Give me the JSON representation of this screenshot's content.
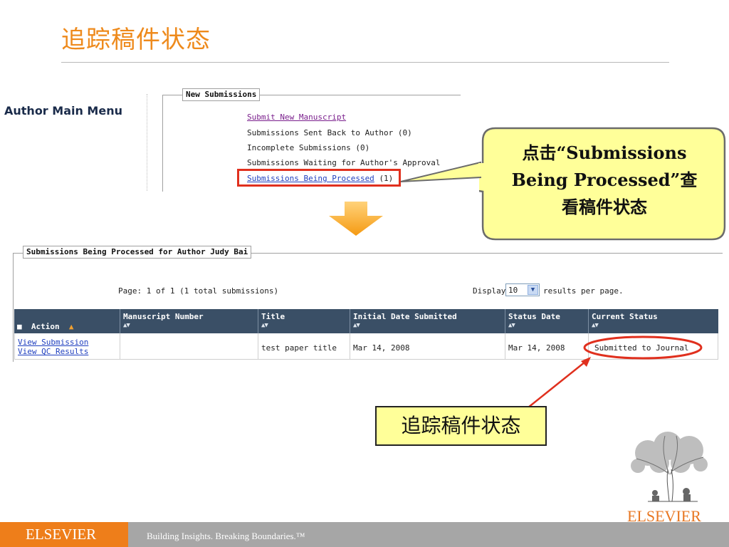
{
  "slide": {
    "title": "追踪稿件状态"
  },
  "author_menu": {
    "label": "Author Main Menu"
  },
  "new_submissions": {
    "legend": "New Submissions",
    "items": [
      {
        "label": "Submit New Manuscript"
      },
      {
        "label": "Submissions Sent Back to Author (0)"
      },
      {
        "label": "Incomplete Submissions (0)"
      },
      {
        "label": "Submissions Waiting for Author's Approval (0)"
      },
      {
        "label": "Submissions Being Processed",
        "count": "(1)"
      }
    ]
  },
  "callout": {
    "text_line1": "点击“Submissions",
    "text_line2": "Being Processed”查",
    "text_line3": "看稿件状态"
  },
  "processed": {
    "legend": "Submissions Being Processed for Author Judy Bai",
    "page_info": "Page: 1 of 1 (1 total submissions)",
    "display_label": "Display",
    "display_value": "10",
    "results_label": "results per page.",
    "columns": [
      {
        "label": "Action"
      },
      {
        "label": "Manuscript Number"
      },
      {
        "label": "Title"
      },
      {
        "label": "Initial Date Submitted"
      },
      {
        "label": "Status Date"
      },
      {
        "label": "Current Status"
      }
    ],
    "rows": [
      {
        "actions": [
          "View Submission",
          "View QC Results"
        ],
        "manuscript_number": "",
        "title": "test paper title",
        "initial_date": "Mar 14, 2008",
        "status_date": "Mar 14, 2008",
        "current_status": "Submitted to Journal"
      }
    ]
  },
  "bottom_label": "追踪稿件状态",
  "logo": {
    "wordmark": "ELSEVIER"
  },
  "footer": {
    "brand": "ELSEVIER",
    "tagline": "Building Insights. Breaking Boundaries.™"
  },
  "colors": {
    "title": "#ee8a1c",
    "callout_fill": "#ffff99",
    "highlight_red": "#e0301e",
    "table_header": "#3a4f66",
    "footer_orange": "#ee7e1a",
    "footer_gray": "#a6a6a6"
  }
}
